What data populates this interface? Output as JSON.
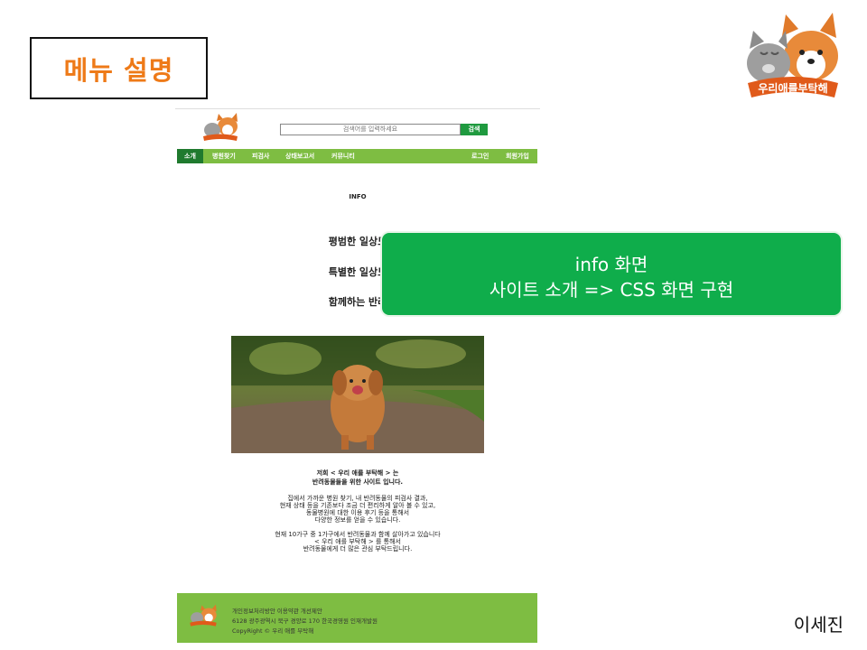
{
  "slide": {
    "title": "메뉴 설명",
    "author": "이세진",
    "logo_text": "우리애를부탁해"
  },
  "site": {
    "search_placeholder": "검색어를 입력하세요",
    "search_button": "검색",
    "nav": {
      "items": [
        "소개",
        "병원찾기",
        "피검사",
        "상태보고서",
        "커뮤니티"
      ],
      "right": [
        "로그인",
        "회원가입"
      ]
    },
    "info_heading": "INFO",
    "taglines": [
      "평범한 일상도",
      "특별한 일상도",
      "함께하는 반려"
    ],
    "intro_title": [
      "저희 < 우리 애를 부탁해 > 는",
      "반려동물들을 위한 사이트 입니다."
    ],
    "intro_body": [
      "집에서 가까운 병원 찾기, 내 반려동물의 피검사 결과,",
      "현재 상태 등을 기존보다 조금 더 편리하게 알아 볼 수 있고,",
      "동물병원에 대한 이용 후기 등을 통해서",
      "다양한 정보를 얻을 수 있습니다."
    ],
    "intro_body2": [
      "현재 10가구 중 1가구에서 반려동물과 함께 살아가고 있습니다",
      "< 우리 애를 부탁해 > 를 통해서",
      "반려동물에게 더 많은 관심 부탁드립니다."
    ],
    "footer": [
      "개인정보처리방안   이용약관   개선제안",
      "6128 광주광역시 북구 경양로 170 한국경영원 인재개발원",
      "CopyRight © 우리 애를 부탁해"
    ]
  },
  "callout": {
    "line1": "info 화면",
    "line2": "사이트 소개 => CSS 화면 구현"
  },
  "colors": {
    "title": "#ee7a18",
    "nav": "#7ebd42",
    "nav_active": "#1f7a2e",
    "search_button": "#1f9a3f",
    "callout": "#0fad4b"
  }
}
